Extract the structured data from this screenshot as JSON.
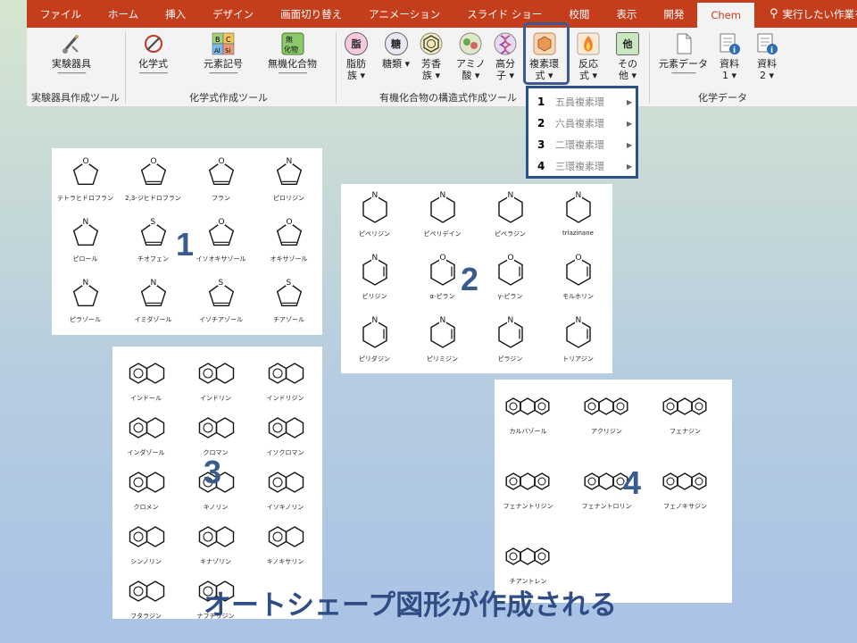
{
  "tabs": [
    "ファイル",
    "ホーム",
    "挿入",
    "デザイン",
    "画面切り替え",
    "アニメーション",
    "スライド ショー",
    "校閲",
    "表示",
    "開発",
    "Chem"
  ],
  "active_tab": "Chem",
  "tell_me": "実行したい作業を",
  "ribbon": {
    "lab": {
      "label": "実験器具",
      "dash": "--------------",
      "group": "実験器具作成ツール"
    },
    "formula": {
      "label": "化学式",
      "dash": "--------------"
    },
    "element_symbol": {
      "label": "元素記号",
      "dash": "--------------"
    },
    "inorganic": {
      "label": "無機化合物",
      "dash": "--------------"
    },
    "formula_group": "化学式作成ツール",
    "aliphatic": {
      "label1": "脂肪",
      "label2": "族",
      "icon": "脂"
    },
    "sugar": {
      "label1": "糖類",
      "icon": "糖"
    },
    "aromatic": {
      "label1": "芳香",
      "label2": "族"
    },
    "amino": {
      "label1": "アミノ",
      "label2": "酸"
    },
    "polymer": {
      "label1": "高分",
      "label2": "子"
    },
    "heterocycle": {
      "label1": "複素環",
      "label2": "式"
    },
    "reaction": {
      "label1": "反応",
      "label2": "式"
    },
    "other": {
      "label1": "その",
      "label2": "他",
      "icon": "他"
    },
    "organic_group": "有機化合物の構造式作成ツール",
    "element_data": {
      "label": "元素データ",
      "dash": "------------"
    },
    "doc1": {
      "label1": "資料",
      "label2": "1"
    },
    "doc2": {
      "label1": "資料",
      "label2": "2"
    },
    "chem_group": "化学データ"
  },
  "dropdown": [
    {
      "num": "1",
      "label": "五員複素環"
    },
    {
      "num": "2",
      "label": "六員複素環"
    },
    {
      "num": "3",
      "label": "二環複素環"
    },
    {
      "num": "4",
      "label": "三環複素環"
    }
  ],
  "panel1": {
    "badge": "1",
    "names": [
      "テトラヒドロフラン",
      "2,3-ジヒドロフラン",
      "フラン",
      "ピロリジン",
      "ピロール",
      "チオフェン",
      "イソオキサゾール",
      "オキサゾール",
      "ピラゾール",
      "イミダゾール",
      "イソチアゾール",
      "チアゾール"
    ]
  },
  "panel2": {
    "badge": "2",
    "names": [
      "ピペリジン",
      "ピペリデイン",
      "ピペラジン",
      "triazinane",
      "ピリジン",
      "α-ピラン",
      "γ-ピラン",
      "モルホリン",
      "ピリダジン",
      "ピリミジン",
      "ピラジン",
      "トリアジン"
    ]
  },
  "panel3": {
    "badge": "3",
    "names": [
      "インドール",
      "インドリン",
      "インドリジン",
      "インダゾール",
      "クロマン",
      "イソクロマン",
      "クロメン",
      "キノリン",
      "イソキノリン",
      "シンノリン",
      "キナゾリン",
      "キノキサリン",
      "フタラジン",
      "ナフチリジン"
    ]
  },
  "panel4": {
    "badge": "4",
    "names": [
      "カルバゾール",
      "アクリジン",
      "フェナジン",
      "フェナントリジン",
      "フェナントロリン",
      "フェノキサジン",
      "チアントレン"
    ]
  },
  "caption": "オートシェープ図形が作成される",
  "colors": {
    "tab_bar": "#c43e1c",
    "highlight": "#2c5289",
    "badge": "#3a5c8c"
  }
}
